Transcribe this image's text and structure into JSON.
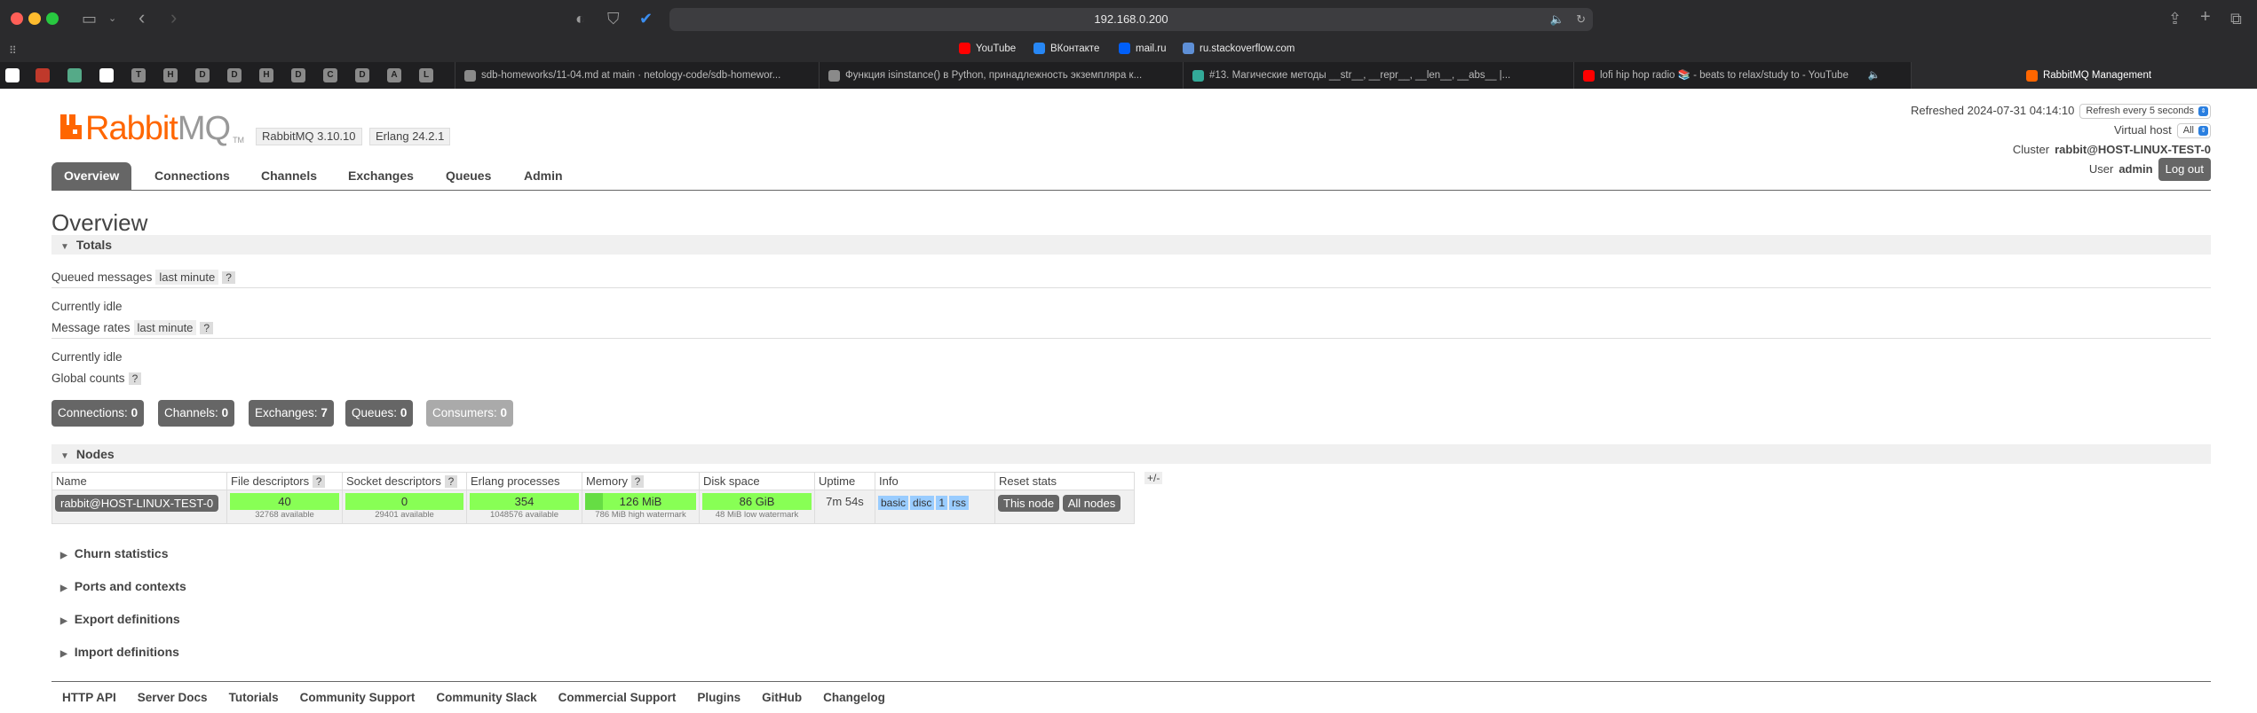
{
  "browser": {
    "url": "192.168.0.200",
    "bookmarks": [
      {
        "label": "YouTube",
        "color": "#ff0000"
      },
      {
        "label": "ВКонтакте",
        "color": "#2787f5"
      },
      {
        "label": "mail.ru",
        "color": "#005ff9"
      },
      {
        "label": "ru.stackoverflow.com",
        "color": "#5e8fd6"
      }
    ],
    "pinned_tabs": [
      "T",
      "H",
      "D",
      "D",
      "H",
      "D",
      "C",
      "D",
      "A",
      "L"
    ],
    "tabs": [
      {
        "label": "sdb-homeworks/11-04.md at main · netology-code/sdb-homewor..."
      },
      {
        "label": "Функция isinstance() в Python, принадлежность экземпляра к..."
      },
      {
        "label": "#13. Магические методы __str__, __repr__, __len__, __abs__ |..."
      },
      {
        "label": "lofi hip hop radio 📚 - beats to relax/study to - YouTube"
      },
      {
        "label": "RabbitMQ Management"
      }
    ]
  },
  "header": {
    "logo_main": "Rabbit",
    "logo_suffix": "MQ",
    "logo_tm": "TM",
    "rabbitmq_version": "RabbitMQ 3.10.10",
    "erlang_version": "Erlang 24.2.1",
    "refreshed_label": "Refreshed 2024-07-31 04:14:10",
    "refresh_select": "Refresh every 5 seconds",
    "vhost_label": "Virtual host",
    "vhost_select": "All",
    "cluster_label": "Cluster",
    "cluster_value": "rabbit@HOST-LINUX-TEST-0",
    "user_label": "User",
    "user_value": "admin",
    "logout": "Log out"
  },
  "nav": {
    "tabs": [
      "Overview",
      "Connections",
      "Channels",
      "Exchanges",
      "Queues",
      "Admin"
    ]
  },
  "overview": {
    "title": "Overview",
    "totals_title": "Totals",
    "queued_messages": "Queued messages",
    "last_minute": "last minute",
    "help": "?",
    "currently_idle": "Currently idle",
    "message_rates": "Message rates",
    "global_counts": "Global counts",
    "counters": [
      {
        "label": "Connections:",
        "value": "0"
      },
      {
        "label": "Channels:",
        "value": "0"
      },
      {
        "label": "Exchanges:",
        "value": "7"
      },
      {
        "label": "Queues:",
        "value": "0"
      },
      {
        "label": "Consumers:",
        "value": "0"
      }
    ]
  },
  "nodes": {
    "title": "Nodes",
    "plus_minus": "+/-",
    "headers": [
      "Name",
      "File descriptors",
      "Socket descriptors",
      "Erlang processes",
      "Memory",
      "Disk space",
      "Uptime",
      "Info",
      "Reset stats"
    ],
    "row": {
      "name": "rabbit@HOST-LINUX-TEST-0",
      "fd": "40",
      "fd_sub": "32768 available",
      "sockets": "0",
      "sockets_sub": "29401 available",
      "procs": "354",
      "procs_sub": "1048576 available",
      "memory": "126 MiB",
      "memory_sub": "786 MiB high watermark",
      "disk": "86 GiB",
      "disk_sub": "48 MiB low watermark",
      "uptime": "7m 54s",
      "info": [
        "basic",
        "disc",
        "1",
        "rss"
      ],
      "reset_this": "This node",
      "reset_all": "All nodes"
    }
  },
  "collapsed_sections": [
    "Churn statistics",
    "Ports and contexts",
    "Export definitions",
    "Import definitions"
  ],
  "footer": [
    "HTTP API",
    "Server Docs",
    "Tutorials",
    "Community Support",
    "Community Slack",
    "Commercial Support",
    "Plugins",
    "GitHub",
    "Changelog"
  ]
}
